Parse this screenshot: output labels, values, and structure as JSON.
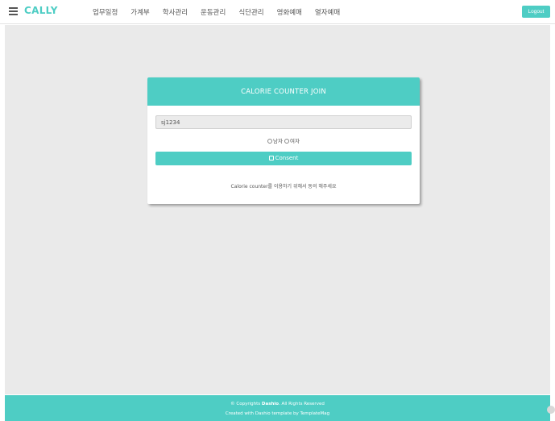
{
  "header": {
    "logo": "CALLY",
    "nav": [
      "업무일정",
      "가계부",
      "학사관리",
      "운동관리",
      "식단관리",
      "영화예매",
      "열자예매"
    ],
    "logout_label": "Logout"
  },
  "card": {
    "title": "CALORIE COUNTER JOIN",
    "input_value": "sj1234",
    "gender_male": "남자",
    "gender_female": "여자",
    "consent_label": "Consent",
    "note": "Calorie counter를 이용하기 위해서 동의 해주세요"
  },
  "footer": {
    "copyright_prefix": "© Copyrights ",
    "copyright_brand": "Dashio",
    "copyright_suffix": ". All Rights Reserved",
    "credit": "Created with Dashio template by TemplateMag"
  },
  "colors": {
    "accent": "#4ecdc4",
    "background": "#eaeaea"
  },
  "icons": [
    "menu-icon",
    "check-icon",
    "radio-icon",
    "scroll-up-icon"
  ]
}
